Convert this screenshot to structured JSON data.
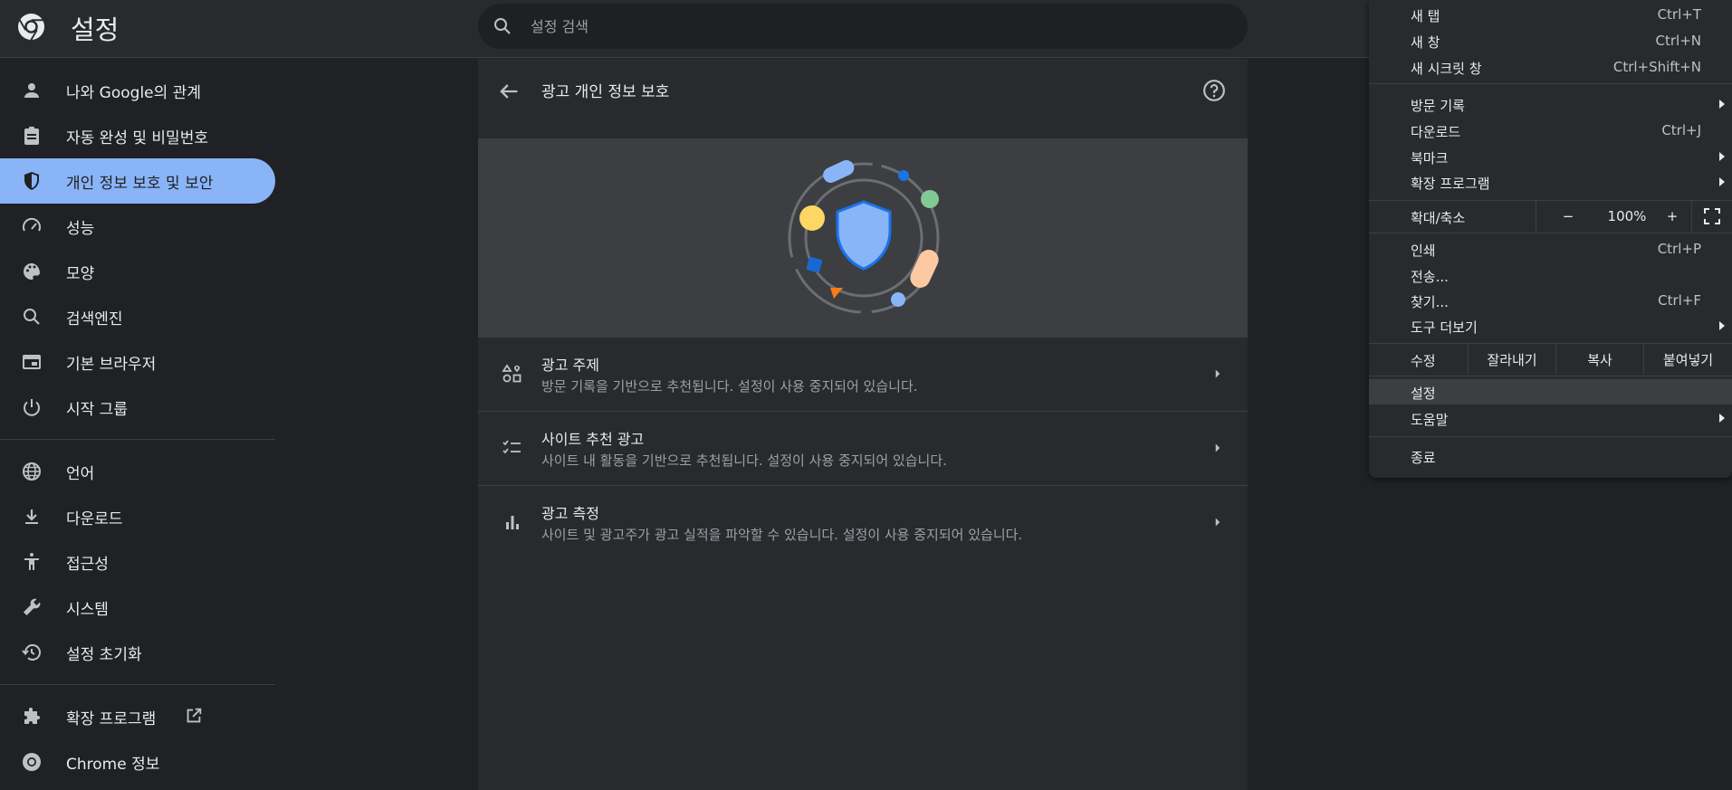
{
  "header": {
    "title": "설정",
    "search_placeholder": "설정 검색"
  },
  "sidebar": {
    "items": [
      {
        "label": "나와 Google의 관계",
        "icon": "person-icon"
      },
      {
        "label": "자동 완성 및 비밀번호",
        "icon": "clipboard-icon"
      },
      {
        "label": "개인 정보 보호 및 보안",
        "icon": "shield-icon",
        "active": true
      },
      {
        "label": "성능",
        "icon": "speedometer-icon"
      },
      {
        "label": "모양",
        "icon": "palette-icon"
      },
      {
        "label": "검색엔진",
        "icon": "search-icon"
      },
      {
        "label": "기본 브라우저",
        "icon": "browser-icon"
      },
      {
        "label": "시작 그룹",
        "icon": "power-icon"
      },
      {
        "label": "언어",
        "icon": "globe-icon"
      },
      {
        "label": "다운로드",
        "icon": "download-icon"
      },
      {
        "label": "접근성",
        "icon": "accessibility-icon"
      },
      {
        "label": "시스템",
        "icon": "wrench-icon"
      },
      {
        "label": "설정 초기화",
        "icon": "history-icon"
      },
      {
        "label": "확장 프로그램",
        "icon": "puzzle-icon"
      },
      {
        "label": "Chrome 정보",
        "icon": "chrome-icon"
      }
    ]
  },
  "main": {
    "title": "광고 개인 정보 보호",
    "rows": [
      {
        "title": "광고 주제",
        "desc": "방문 기록을 기반으로 추천됩니다. 설정이 사용 중지되어 있습니다.",
        "icon": "topics-icon"
      },
      {
        "title": "사이트 추천 광고",
        "desc": "사이트 내 활동을 기반으로 추천됩니다. 설정이 사용 중지되어 있습니다.",
        "icon": "checklist-icon"
      },
      {
        "title": "광고 측정",
        "desc": "사이트 및 광고주가 광고 실적을 파악할 수 있습니다. 설정이 사용 중지되어 있습니다.",
        "icon": "bar-chart-icon"
      }
    ]
  },
  "menu": {
    "new_tab": {
      "label": "새 탭",
      "shortcut": "Ctrl+T"
    },
    "new_window": {
      "label": "새 창",
      "shortcut": "Ctrl+N"
    },
    "incognito": {
      "label": "새 시크릿 창",
      "shortcut": "Ctrl+Shift+N"
    },
    "history": {
      "label": "방문 기록"
    },
    "downloads": {
      "label": "다운로드",
      "shortcut": "Ctrl+J"
    },
    "bookmarks": {
      "label": "북마크"
    },
    "extensions": {
      "label": "확장 프로그램"
    },
    "zoom": {
      "label": "확대/축소",
      "minus": "−",
      "value": "100%",
      "plus": "+"
    },
    "print": {
      "label": "인쇄",
      "shortcut": "Ctrl+P"
    },
    "cast": {
      "label": "전송..."
    },
    "find": {
      "label": "찾기...",
      "shortcut": "Ctrl+F"
    },
    "more_tools": {
      "label": "도구 더보기"
    },
    "edit": {
      "label": "수정",
      "cut": "잘라내기",
      "copy": "복사",
      "paste": "붙여넣기"
    },
    "settings": {
      "label": "설정"
    },
    "help": {
      "label": "도움말"
    },
    "exit": {
      "label": "종료"
    }
  },
  "colors": {
    "accent": "#8ab4f8",
    "background": "#202124",
    "card": "#292a2d"
  }
}
